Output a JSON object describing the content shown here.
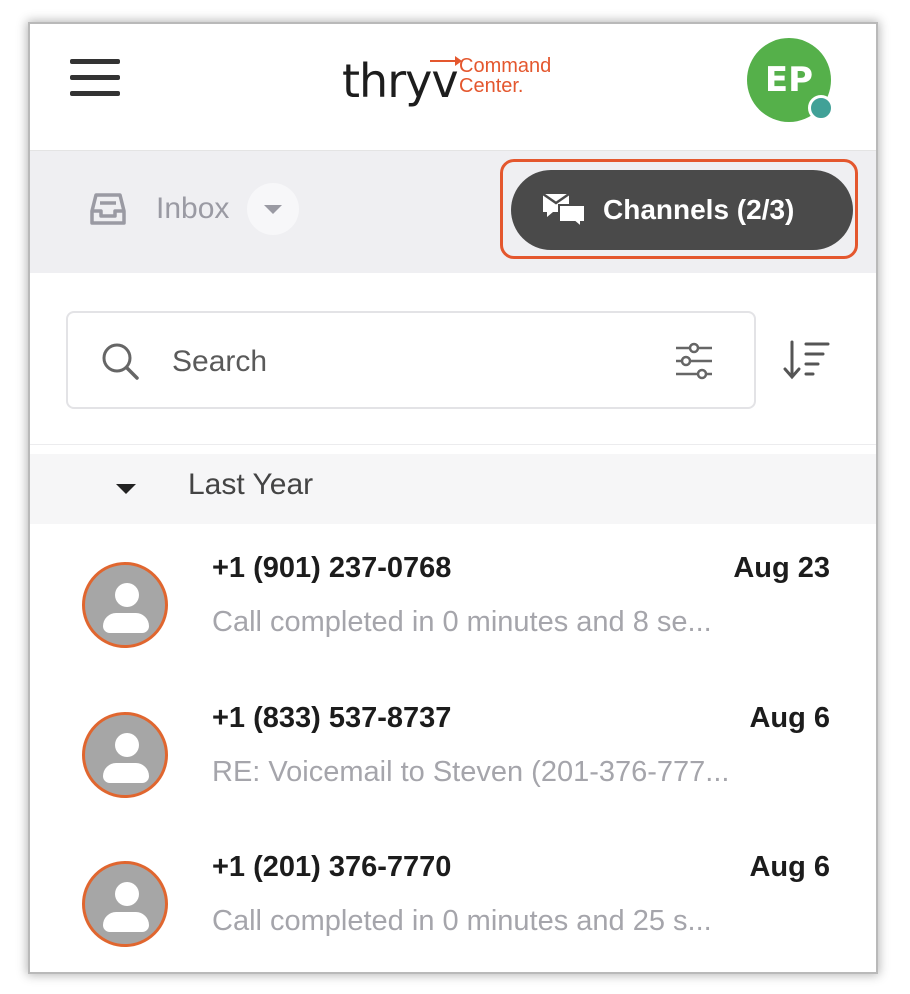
{
  "header": {
    "logo_main": "thryv",
    "logo_sub_line1": "Command",
    "logo_sub_line2": "Center.",
    "user_initials": "EP"
  },
  "toolbar": {
    "inbox_label": "Inbox",
    "channels_label": "Channels (2/3)"
  },
  "search": {
    "placeholder": "Search"
  },
  "section": {
    "label": "Last Year"
  },
  "conversations": [
    {
      "name": "+1 (901) 237-0768",
      "date": "Aug 23",
      "preview": "Call completed in 0 minutes and 8 se..."
    },
    {
      "name": "+1 (833) 537-8737",
      "date": "Aug 6",
      "preview": "RE: Voicemail to Steven (201-376-777..."
    },
    {
      "name": "+1 (201) 376-7770",
      "date": "Aug 6",
      "preview": "Call completed in 0 minutes and 25 s..."
    }
  ],
  "icons": {
    "menu": "hamburger-menu-icon",
    "inbox": "inbox-tray-icon",
    "channels": "chat-bubbles-icon",
    "search": "search-icon",
    "filter": "filter-sliders-icon",
    "sort": "sort-icon",
    "contact": "person-avatar-icon"
  },
  "colors": {
    "brand_orange": "#e4572e",
    "avatar_green": "#55b04a",
    "status_teal": "#41a197",
    "channels_bg": "#4a4a4a",
    "toolbar_bg": "#efeff2"
  }
}
